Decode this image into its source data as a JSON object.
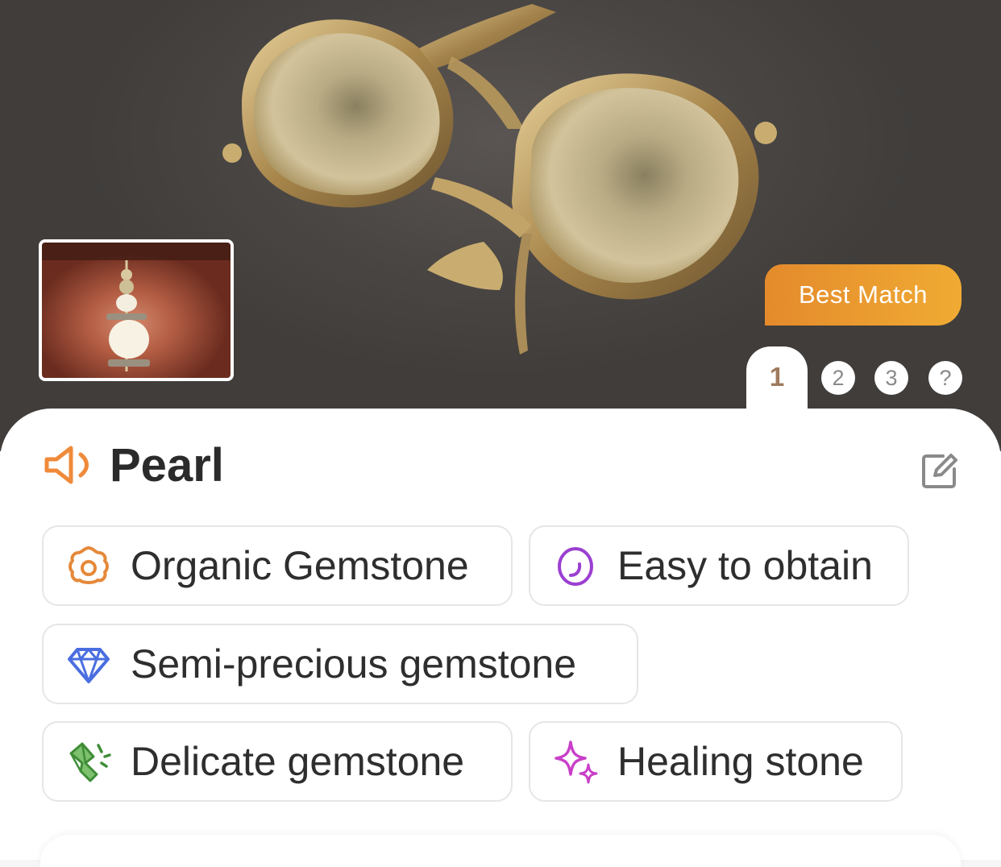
{
  "hero": {
    "badge_label": "Best Match",
    "pages": [
      "1",
      "2",
      "3",
      "?"
    ],
    "active_page": "1"
  },
  "result": {
    "title": "Pearl",
    "tags": [
      {
        "label": "Organic Gemstone",
        "icon": "oyster-pearl-icon",
        "color": "#e5893a"
      },
      {
        "label": "Easy to obtain",
        "icon": "oval-stone-icon",
        "color": "#9b3fd1"
      },
      {
        "label": "Semi-precious gemstone",
        "icon": "diamond-icon",
        "color": "#4a6ee0"
      },
      {
        "label": "Delicate gemstone",
        "icon": "broken-crystal-icon",
        "color": "#4a9a42"
      },
      {
        "label": "Healing stone",
        "icon": "sparkles-icon",
        "color": "#c93fc9"
      }
    ]
  },
  "colors": {
    "accent_orange": "#ef9a32",
    "title_text": "#2b2b2b"
  }
}
